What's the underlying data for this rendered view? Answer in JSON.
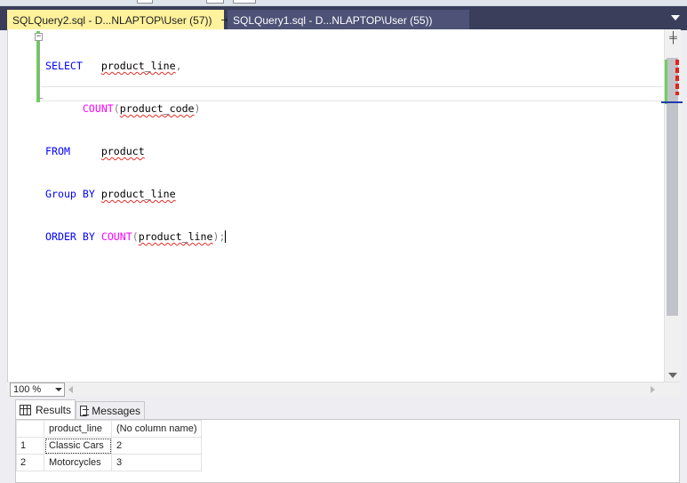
{
  "tabs": [
    {
      "label": "SQLQuery2.sql - D...NLAPTOP\\User (57))",
      "active": true
    },
    {
      "label": "SQLQuery1.sql - D...NLAPTOP\\User (55))",
      "active": false
    }
  ],
  "tab_icons": {
    "pin": "pin-icon",
    "close": "close-icon",
    "overflow": "chevron-down-icon"
  },
  "editor": {
    "lines": {
      "l1_kw": "SELECT",
      "l1_ident": "product_line",
      "l1_punct": ",",
      "l2_fn": "COUNT",
      "l2_open": "(",
      "l2_ident": "product_code",
      "l2_close": ")",
      "l3_kw": "FROM",
      "l3_ident": "product",
      "l4_kw1": "Group",
      "l4_kw2": "BY",
      "l4_ident": "product_line",
      "l5_kw1": "ORDER",
      "l5_kw2": "BY",
      "l5_fn": "COUNT",
      "l5_open": "(",
      "l5_ident": "product_line",
      "l5_close": ");"
    },
    "collapse_glyph": "−"
  },
  "zoom": {
    "value": "100 %"
  },
  "results": {
    "tabs": {
      "results": "Results",
      "messages": "Messages"
    },
    "columns": [
      "product_line",
      "(No column name)"
    ],
    "rows": [
      {
        "num": "1",
        "product_line": "Classic Cars",
        "count": "2"
      },
      {
        "num": "2",
        "product_line": "Motorcycles",
        "count": "3"
      }
    ]
  },
  "colors": {
    "tabbar": "#3a3e5b",
    "active_tab": "#fff29d",
    "inactive_tab": "#4d5276",
    "keyword": "#0000ff",
    "function": "#ff00ff",
    "punctuation": "#808080",
    "change_marker": "#6fcf5f",
    "error_squiggle": "#e0302a"
  }
}
